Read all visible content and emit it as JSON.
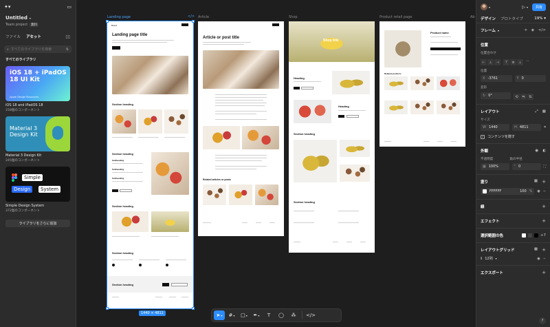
{
  "left_panel": {
    "project_title": "Untitled",
    "team_label": "Team project",
    "free_badge": "無料",
    "tabs": [
      "ファイル",
      "アセット"
    ],
    "search_placeholder": "すべてのライブラリを検索",
    "section_title": "すべてのライブラリ",
    "kits": [
      {
        "thumb_title": "iOS 18 + iPadOS 18 UI Kit",
        "thumb_caption": "Apple Design Resources",
        "name": "iOS 18 and iPadOS 18",
        "count": "158個のコンポーネント"
      },
      {
        "thumb_title": "Material 3 Design Kit",
        "name": "Material 3 Design Kit",
        "count": "245個のコンポーネント"
      },
      {
        "thumb_words": [
          "Simple",
          "Design",
          "System"
        ],
        "name": "Simple Design System",
        "count": "372個のコンポーネント"
      }
    ],
    "more_button": "ライブラリをさらに追加"
  },
  "canvas": {
    "frames": [
      {
        "label": "Landing page",
        "selected": true
      },
      {
        "label": "Article"
      },
      {
        "label": "Shop"
      },
      {
        "label": "Product retail page"
      },
      {
        "label": "Ab"
      }
    ],
    "selection_size": "1440 × 4811",
    "code_icon": "</>",
    "landing": {
      "nav": "Brand",
      "title": "Landing page title",
      "sections": [
        "Section heading",
        "Section heading",
        "Section heading",
        "Section heading",
        "Section heading"
      ],
      "subheads": [
        "Subheading",
        "Subheading",
        "Subheading"
      ]
    },
    "article": {
      "title": "Article or post title",
      "related": "Related articles or posts"
    },
    "shop": {
      "title": "Shop title",
      "headings": [
        "Heading",
        "Heading"
      ],
      "section": "Section heading",
      "section2": "Section heading"
    },
    "product": {
      "name": "Product name",
      "related": "Related products"
    }
  },
  "toolbar": {
    "items": [
      "move",
      "frame",
      "shape",
      "pen",
      "text",
      "comment",
      "actions",
      "dev-mode"
    ]
  },
  "right_panel": {
    "tabs": [
      "デザイン",
      "プロトタイプ"
    ],
    "zoom": "19%",
    "share": "共有",
    "frame_title": "フレーム",
    "position": {
      "title": "位置",
      "alignment": "位置合わせ",
      "position_label": "位置",
      "x": "-3761",
      "y": "0",
      "rotation_label": "変形",
      "rotation": "0°"
    },
    "layout": {
      "title": "レイアウト",
      "size_label": "サイズ",
      "w": "1440",
      "h": "4811",
      "clip": "コンテンツを隠す"
    },
    "appearance": {
      "title": "外観",
      "opacity_label": "不透明度",
      "opacity": "100%",
      "radius_label": "角の半径",
      "radius": "0"
    },
    "fill": {
      "title": "塗り",
      "hex": "FFFFFF",
      "opacity": "100",
      "unit": "%"
    },
    "stroke_title": "線",
    "effects_title": "エフェクト",
    "selection_colors": {
      "title": "選択範囲の色",
      "more": "+7"
    },
    "layout_grid": {
      "title": "レイアウトグリッド",
      "value": "12列"
    },
    "export_title": "エクスポート",
    "help": "?"
  }
}
